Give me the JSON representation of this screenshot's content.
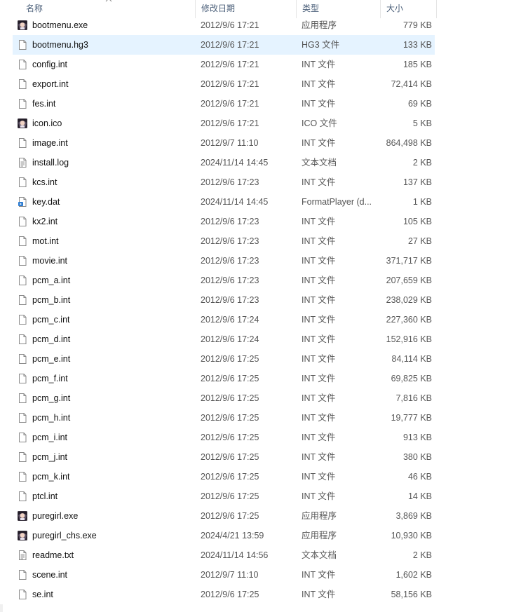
{
  "columns": {
    "name": "名称",
    "date": "修改日期",
    "type": "类型",
    "size": "大小"
  },
  "files": [
    {
      "name": "bootmenu.exe",
      "date": "2012/9/6 17:21",
      "type": "应用程序",
      "size": "779 KB",
      "icon": "app-avatar-icon"
    },
    {
      "name": "bootmenu.hg3",
      "date": "2012/9/6 17:21",
      "type": "HG3 文件",
      "size": "133 KB",
      "icon": "file-icon",
      "selected": true
    },
    {
      "name": "config.int",
      "date": "2012/9/6 17:21",
      "type": "INT 文件",
      "size": "185 KB",
      "icon": "file-icon"
    },
    {
      "name": "export.int",
      "date": "2012/9/6 17:21",
      "type": "INT 文件",
      "size": "72,414 KB",
      "icon": "file-icon"
    },
    {
      "name": "fes.int",
      "date": "2012/9/6 17:21",
      "type": "INT 文件",
      "size": "69 KB",
      "icon": "file-icon"
    },
    {
      "name": "icon.ico",
      "date": "2012/9/6 17:21",
      "type": "ICO 文件",
      "size": "5 KB",
      "icon": "app-avatar-icon"
    },
    {
      "name": "image.int",
      "date": "2012/9/7 11:10",
      "type": "INT 文件",
      "size": "864,498 KB",
      "icon": "file-icon"
    },
    {
      "name": "install.log",
      "date": "2024/11/14 14:45",
      "type": "文本文档",
      "size": "2 KB",
      "icon": "text-file-icon"
    },
    {
      "name": "kcs.int",
      "date": "2012/9/6 17:23",
      "type": "INT 文件",
      "size": "137 KB",
      "icon": "file-icon"
    },
    {
      "name": "key.dat",
      "date": "2024/11/14 14:45",
      "type": "FormatPlayer (d...",
      "size": "1 KB",
      "icon": "media-file-icon"
    },
    {
      "name": "kx2.int",
      "date": "2012/9/6 17:23",
      "type": "INT 文件",
      "size": "105 KB",
      "icon": "file-icon"
    },
    {
      "name": "mot.int",
      "date": "2012/9/6 17:23",
      "type": "INT 文件",
      "size": "27 KB",
      "icon": "file-icon"
    },
    {
      "name": "movie.int",
      "date": "2012/9/6 17:23",
      "type": "INT 文件",
      "size": "371,717 KB",
      "icon": "file-icon"
    },
    {
      "name": "pcm_a.int",
      "date": "2012/9/6 17:23",
      "type": "INT 文件",
      "size": "207,659 KB",
      "icon": "file-icon"
    },
    {
      "name": "pcm_b.int",
      "date": "2012/9/6 17:23",
      "type": "INT 文件",
      "size": "238,029 KB",
      "icon": "file-icon"
    },
    {
      "name": "pcm_c.int",
      "date": "2012/9/6 17:24",
      "type": "INT 文件",
      "size": "227,360 KB",
      "icon": "file-icon"
    },
    {
      "name": "pcm_d.int",
      "date": "2012/9/6 17:24",
      "type": "INT 文件",
      "size": "152,916 KB",
      "icon": "file-icon"
    },
    {
      "name": "pcm_e.int",
      "date": "2012/9/6 17:25",
      "type": "INT 文件",
      "size": "84,114 KB",
      "icon": "file-icon"
    },
    {
      "name": "pcm_f.int",
      "date": "2012/9/6 17:25",
      "type": "INT 文件",
      "size": "69,825 KB",
      "icon": "file-icon"
    },
    {
      "name": "pcm_g.int",
      "date": "2012/9/6 17:25",
      "type": "INT 文件",
      "size": "7,816 KB",
      "icon": "file-icon"
    },
    {
      "name": "pcm_h.int",
      "date": "2012/9/6 17:25",
      "type": "INT 文件",
      "size": "19,777 KB",
      "icon": "file-icon"
    },
    {
      "name": "pcm_i.int",
      "date": "2012/9/6 17:25",
      "type": "INT 文件",
      "size": "913 KB",
      "icon": "file-icon"
    },
    {
      "name": "pcm_j.int",
      "date": "2012/9/6 17:25",
      "type": "INT 文件",
      "size": "380 KB",
      "icon": "file-icon"
    },
    {
      "name": "pcm_k.int",
      "date": "2012/9/6 17:25",
      "type": "INT 文件",
      "size": "46 KB",
      "icon": "file-icon"
    },
    {
      "name": "ptcl.int",
      "date": "2012/9/6 17:25",
      "type": "INT 文件",
      "size": "14 KB",
      "icon": "file-icon"
    },
    {
      "name": "puregirl.exe",
      "date": "2012/9/6 17:25",
      "type": "应用程序",
      "size": "3,869 KB",
      "icon": "app-avatar-icon"
    },
    {
      "name": "puregirl_chs.exe",
      "date": "2024/4/21 13:59",
      "type": "应用程序",
      "size": "10,930 KB",
      "icon": "app-avatar-icon"
    },
    {
      "name": "readme.txt",
      "date": "2024/11/14 14:56",
      "type": "文本文档",
      "size": "2 KB",
      "icon": "text-file-icon"
    },
    {
      "name": "scene.int",
      "date": "2012/9/7 11:10",
      "type": "INT 文件",
      "size": "1,602 KB",
      "icon": "file-icon"
    },
    {
      "name": "se.int",
      "date": "2012/9/6 17:25",
      "type": "INT 文件",
      "size": "58,156 KB",
      "icon": "file-icon"
    }
  ],
  "colors": {
    "selection": "#e5f3ff",
    "header_text": "#4c607a",
    "cell_text": "#555555"
  }
}
